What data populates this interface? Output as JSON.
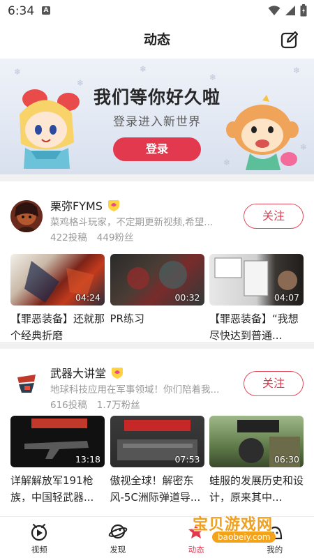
{
  "status_bar": {
    "time": "6:34",
    "notification_letter": "A"
  },
  "header": {
    "title": "动态"
  },
  "banner": {
    "title": "我们等你好久啦",
    "subtitle": "登录进入新世界",
    "login_label": "登录"
  },
  "creators": [
    {
      "name": "栗弥FYMS",
      "description": "菜鸡格斗玩家，不定期更新视频,希望...",
      "posts": "422投稿",
      "fans": "449粉丝",
      "follow_label": "关注",
      "videos": [
        {
          "duration": "04:24",
          "title": "【罪恶装备】还就那个经典折磨"
        },
        {
          "duration": "00:32",
          "title": "PR练习"
        },
        {
          "duration": "04:07",
          "title": "【罪恶装备】“我想尽快达到普通..."
        }
      ]
    },
    {
      "name": "武器大讲堂",
      "description": "地球科技应用在军事领域！你们陪着我...",
      "posts": "616投稿",
      "fans": "1.7万粉丝",
      "follow_label": "关注",
      "videos": [
        {
          "duration": "13:18",
          "title": "详解解放军191枪族，中国轻武器..."
        },
        {
          "duration": "07:53",
          "title": "傲视全球！解密东风-5C洲际弹道导..."
        },
        {
          "duration": "06:30",
          "title": "蛙服的发展历史和设计，原来其中..."
        }
      ]
    }
  ],
  "bottom_nav": [
    {
      "label": "视频",
      "icon": "video-icon"
    },
    {
      "label": "发现",
      "icon": "planet-icon"
    },
    {
      "label": "动态",
      "icon": "dynamic-icon",
      "active": true
    },
    {
      "label": "我的",
      "icon": "profile-icon"
    }
  ],
  "watermark": {
    "text": "宝贝游戏网",
    "url": "baobeiy.com"
  },
  "colors": {
    "accent": "#e2394f",
    "divider": "#f1f1f1",
    "muted_text": "#9a9a9a"
  }
}
